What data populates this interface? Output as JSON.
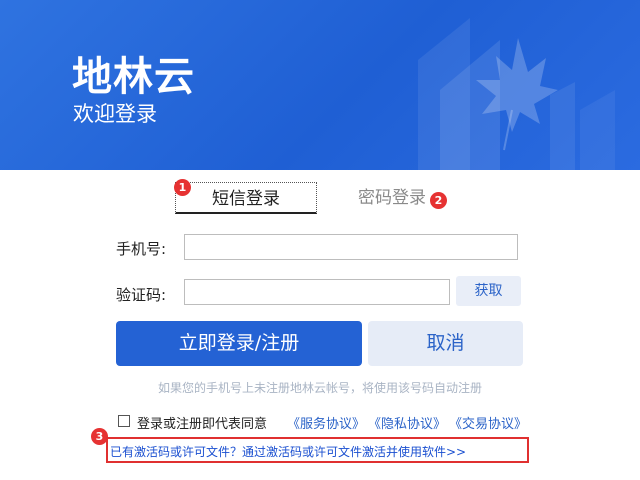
{
  "brand": {
    "title": "地林云",
    "subtitle": "欢迎登录"
  },
  "tabs": [
    {
      "label": "短信登录",
      "active": true,
      "badge": "1"
    },
    {
      "label": "密码登录",
      "active": false,
      "badge": "2"
    }
  ],
  "form": {
    "phone_label": "手机号:",
    "phone_value": "",
    "code_label": "验证码:",
    "code_value": "",
    "get_code_label": "获取"
  },
  "buttons": {
    "login": "立即登录/注册",
    "cancel": "取消"
  },
  "hint": "如果您的手机号上未注册地林云帐号，将使用该号码自动注册",
  "agreement": {
    "checked": false,
    "text": "登录或注册即代表同意",
    "links": [
      "《服务协议》",
      "《隐私协议》",
      "《交易协议》"
    ]
  },
  "activation": {
    "badge": "3",
    "link": "已有激活码或许可文件？通过激活码或许可文件激活并使用软件>>"
  },
  "colors": {
    "banner": "#1f5fd4",
    "primary": "#2462d4",
    "badge": "#e63232",
    "link": "#2b63c8"
  },
  "icons": {
    "deco": "maple-leaf-icon"
  }
}
